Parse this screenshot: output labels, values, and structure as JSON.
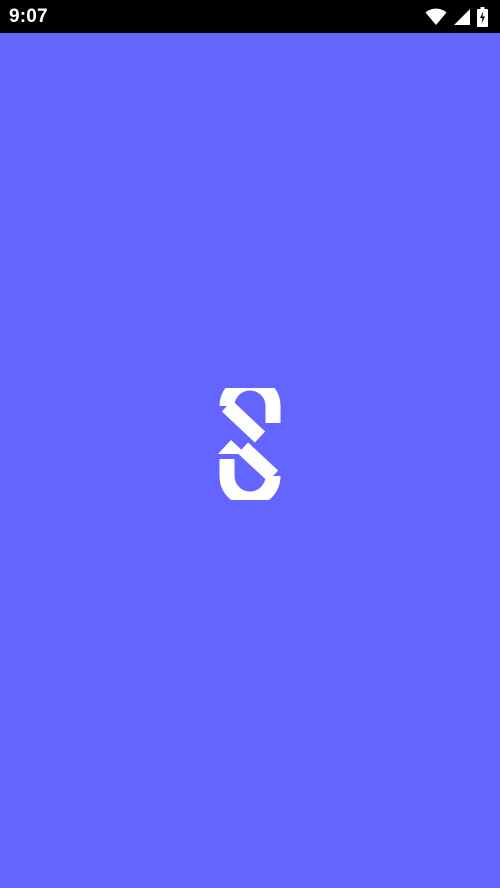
{
  "status_bar": {
    "time": "9:07",
    "icons": [
      "wifi-icon",
      "cellular-signal-icon",
      "battery-charging-icon"
    ]
  },
  "splash": {
    "background_color": "#6464ff",
    "logo_color": "#ffffff",
    "logo_icon": "app-logo-icon"
  }
}
